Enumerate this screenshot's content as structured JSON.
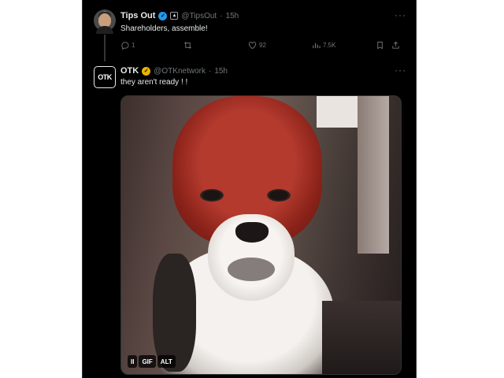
{
  "colors": {
    "background": "#000000",
    "text_primary": "#e7e9ea",
    "text_secondary": "#71767b",
    "verified_blue": "#1d9bf0",
    "verified_gold": "#e8b400"
  },
  "tweets": [
    {
      "display_name": "Tips Out",
      "handle": "@TipsOut",
      "separator": "·",
      "time": "15h",
      "verified_badge": "blue-check-icon",
      "extra_badge": "affiliate-badge-icon",
      "text": "Shareholders, assemble!",
      "actions": {
        "replies": "1",
        "reposts": "",
        "likes": "92",
        "views": "7.5K"
      }
    },
    {
      "display_name": "OTK",
      "handle": "@OTKnetwork",
      "separator": "·",
      "time": "15h",
      "verified_badge": "gold-check-icon",
      "avatar_text": "OTK",
      "text": "they aren't ready ! !",
      "media": {
        "type": "gif",
        "pause_label": "II",
        "gif_label": "GIF",
        "alt_label": "ALT"
      }
    }
  ],
  "more_label": "···"
}
